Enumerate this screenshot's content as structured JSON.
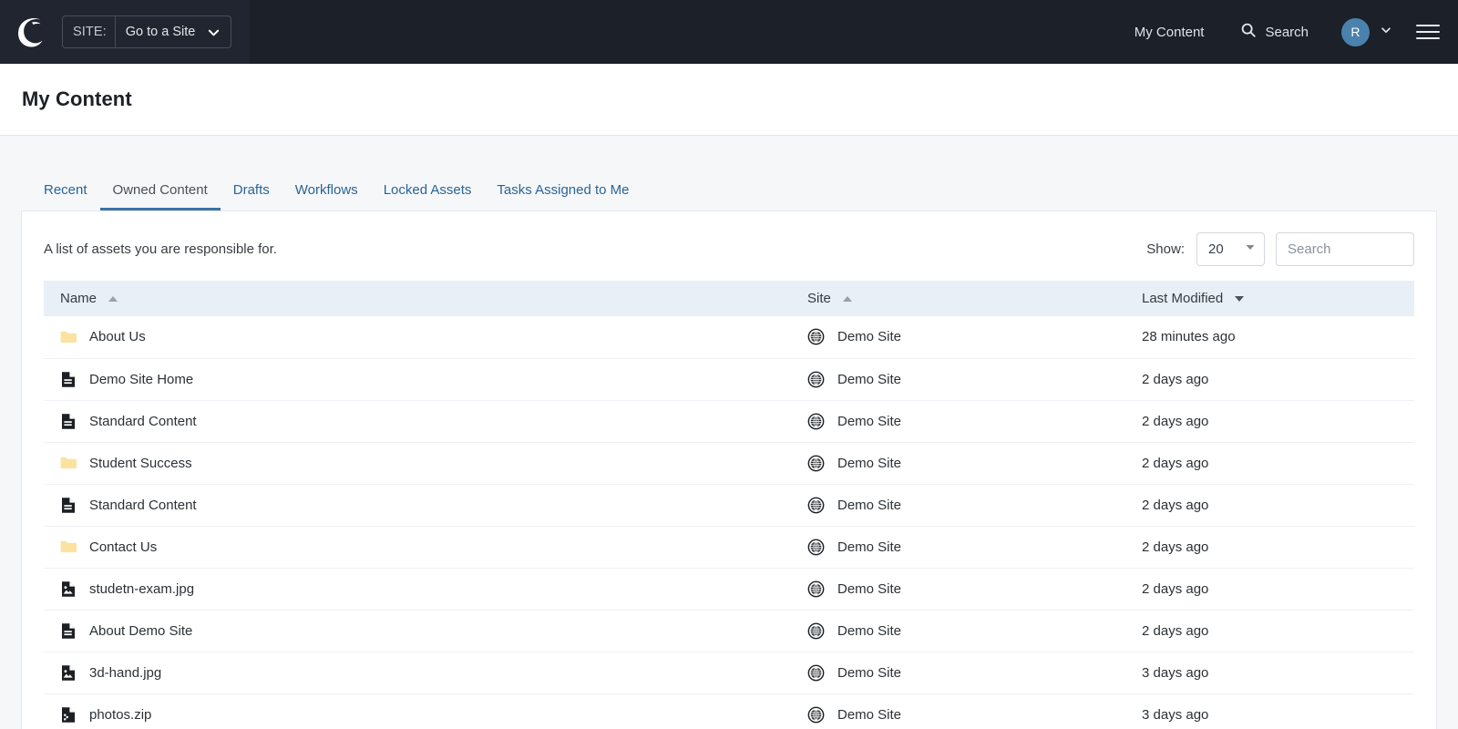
{
  "topnav": {
    "logo_icon": "cascade-crescent-logo",
    "site_label": "SITE:",
    "site_value": "Go to a Site",
    "site_caret_icon": "chevron-down-icon",
    "my_content_label": "My Content",
    "search_label": "Search",
    "search_icon": "search-icon",
    "avatar_initial": "R",
    "avatar_caret_icon": "chevron-down-icon",
    "menu_icon": "hamburger-menu-icon",
    "bg_color": "#1b2029",
    "avatar_color": "#4a82ad"
  },
  "header": {
    "title": "My Content"
  },
  "tabs": [
    {
      "label": "Recent",
      "active": false
    },
    {
      "label": "Owned Content",
      "active": true
    },
    {
      "label": "Drafts",
      "active": false
    },
    {
      "label": "Workflows",
      "active": false
    },
    {
      "label": "Locked Assets",
      "active": false
    },
    {
      "label": "Tasks Assigned to Me",
      "active": false
    }
  ],
  "toolbar": {
    "description": "A list of assets you are responsible for.",
    "show_label": "Show:",
    "show_value": "20",
    "show_caret_icon": "caret-down-icon",
    "search_placeholder": "Search",
    "search_value": ""
  },
  "table": {
    "columns": [
      {
        "label": "Name",
        "sort": "asc",
        "sort_icon": "sort-ascending-icon"
      },
      {
        "label": "Site",
        "sort": "asc",
        "sort_icon": "sort-ascending-icon"
      },
      {
        "label": "Last Modified",
        "sort": "desc",
        "sort_icon": "sort-descending-icon"
      }
    ],
    "rows": [
      {
        "icon": "folder-icon",
        "name": "About Us",
        "site_icon": "globe-icon",
        "site": "Demo Site",
        "modified": "28 minutes ago"
      },
      {
        "icon": "page-icon",
        "name": "Demo Site Home",
        "site_icon": "globe-icon",
        "site": "Demo Site",
        "modified": "2 days ago"
      },
      {
        "icon": "page-icon",
        "name": "Standard Content",
        "site_icon": "globe-icon",
        "site": "Demo Site",
        "modified": "2 days ago"
      },
      {
        "icon": "folder-icon",
        "name": "Student Success",
        "site_icon": "globe-icon",
        "site": "Demo Site",
        "modified": "2 days ago"
      },
      {
        "icon": "page-icon",
        "name": "Standard Content",
        "site_icon": "globe-icon",
        "site": "Demo Site",
        "modified": "2 days ago"
      },
      {
        "icon": "folder-icon",
        "name": "Contact Us",
        "site_icon": "globe-icon",
        "site": "Demo Site",
        "modified": "2 days ago"
      },
      {
        "icon": "image-file-icon",
        "name": "studetn-exam.jpg",
        "site_icon": "globe-icon",
        "site": "Demo Site",
        "modified": "2 days ago"
      },
      {
        "icon": "page-icon",
        "name": "About Demo Site",
        "site_icon": "globe-icon",
        "site": "Demo Site",
        "modified": "2 days ago"
      },
      {
        "icon": "image-file-icon",
        "name": "3d-hand.jpg",
        "site_icon": "globe-icon",
        "site": "Demo Site",
        "modified": "3 days ago"
      },
      {
        "icon": "archive-file-icon",
        "name": "photos.zip",
        "site_icon": "globe-icon",
        "site": "Demo Site",
        "modified": "3 days ago"
      }
    ]
  }
}
